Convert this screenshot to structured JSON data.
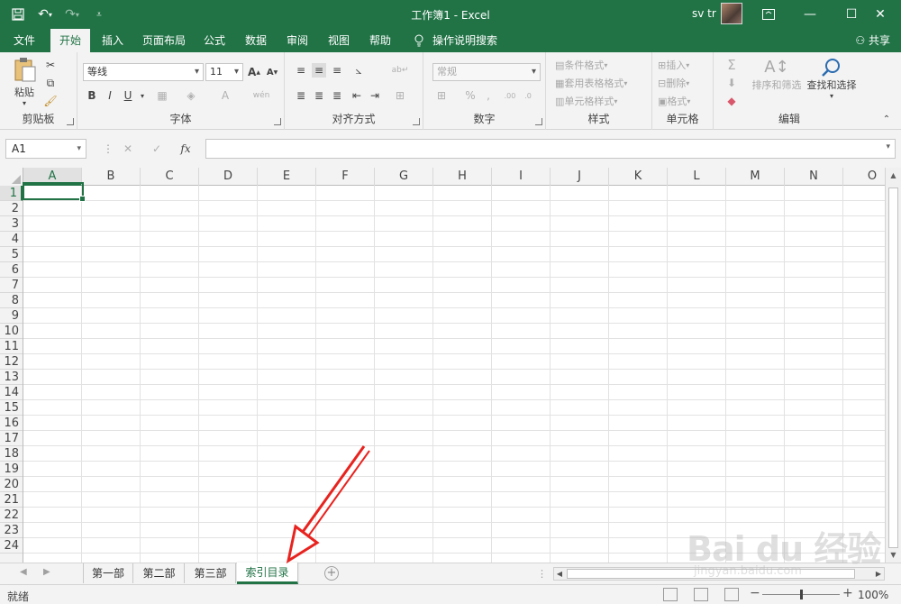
{
  "titlebar": {
    "title": "工作簿1  -  Excel",
    "user": "sv tr",
    "save_icon": "save-icon",
    "undo_icon": "undo-icon",
    "redo_icon": "redo-icon",
    "customize_icon": "qat-customize-icon"
  },
  "tabs": {
    "file": "文件",
    "home": "开始",
    "insert": "插入",
    "page_layout": "页面布局",
    "formulas": "公式",
    "data": "数据",
    "review": "审阅",
    "view": "视图",
    "help": "帮助",
    "tell_me": "操作说明搜索",
    "share": "共享"
  },
  "ribbon": {
    "clipboard": {
      "label": "剪贴板",
      "paste": "粘贴"
    },
    "font": {
      "label": "字体",
      "font_name": "等线",
      "font_size": "11",
      "bold": "B",
      "italic": "I",
      "underline": "U"
    },
    "alignment": {
      "label": "对齐方式"
    },
    "number": {
      "label": "数字",
      "format": "常规",
      "percent": "%"
    },
    "styles": {
      "label": "样式",
      "conditional": "条件格式",
      "table": "套用表格格式",
      "cell_styles": "单元格样式"
    },
    "cells": {
      "label": "单元格",
      "insert": "插入",
      "delete": "删除",
      "format": "格式"
    },
    "editing": {
      "label": "编辑",
      "sort_filter": "排序和筛选",
      "find_select": "查找和选择"
    }
  },
  "formula_bar": {
    "name_box": "A1",
    "cancel": "✕",
    "enter": "✓",
    "fx": "fx",
    "value": ""
  },
  "grid": {
    "columns": [
      "A",
      "B",
      "C",
      "D",
      "E",
      "F",
      "G",
      "H",
      "I",
      "J",
      "K",
      "L",
      "M",
      "N",
      "O"
    ],
    "rows": [
      "1",
      "2",
      "3",
      "4",
      "5",
      "6",
      "7",
      "8",
      "9",
      "10",
      "11",
      "12",
      "13",
      "14",
      "15",
      "16",
      "17",
      "18",
      "19",
      "20",
      "21",
      "22",
      "23",
      "24"
    ],
    "active_cell": "A1"
  },
  "sheets": {
    "tabs": [
      "第一部",
      "第二部",
      "第三部",
      "索引目录"
    ],
    "active": "索引目录"
  },
  "status": {
    "ready": "就绪",
    "zoom": "100%"
  },
  "watermark": {
    "brand": "Bai du 经验",
    "url": "jingyan.baidu.com"
  },
  "colors": {
    "excel_green": "#217346",
    "annotation_red": "#e8231f"
  }
}
